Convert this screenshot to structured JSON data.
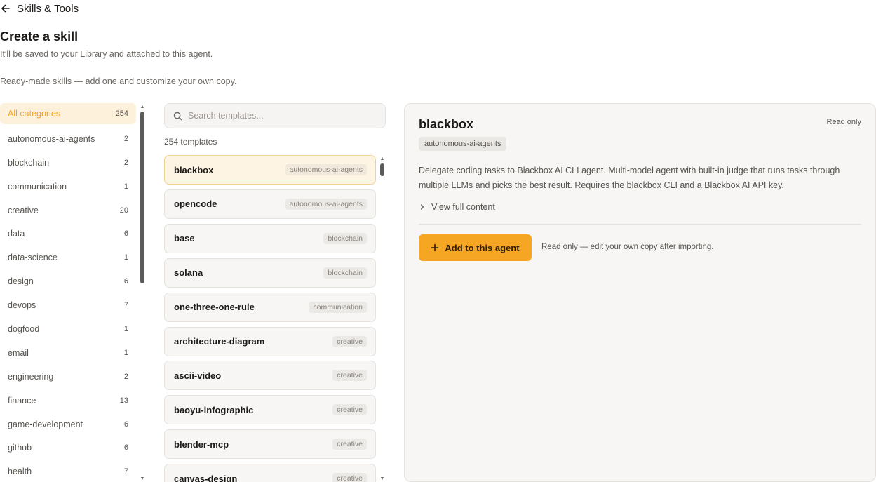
{
  "header": {
    "title": "Skills & Tools"
  },
  "page": {
    "title": "Create a skill",
    "subtitle": "It'll be saved to your Library and attached to this agent.",
    "section_note": "Ready-made skills — add one and customize your own copy."
  },
  "categories": [
    {
      "label": "All categories",
      "count": "254",
      "active": true
    },
    {
      "label": "autonomous-ai-agents",
      "count": "2"
    },
    {
      "label": "blockchain",
      "count": "2"
    },
    {
      "label": "communication",
      "count": "1"
    },
    {
      "label": "creative",
      "count": "20"
    },
    {
      "label": "data",
      "count": "6"
    },
    {
      "label": "data-science",
      "count": "1"
    },
    {
      "label": "design",
      "count": "6"
    },
    {
      "label": "devops",
      "count": "7"
    },
    {
      "label": "dogfood",
      "count": "1"
    },
    {
      "label": "email",
      "count": "1"
    },
    {
      "label": "engineering",
      "count": "2"
    },
    {
      "label": "finance",
      "count": "13"
    },
    {
      "label": "game-development",
      "count": "6"
    },
    {
      "label": "github",
      "count": "6"
    },
    {
      "label": "health",
      "count": "7"
    }
  ],
  "search": {
    "placeholder": "Search templates...",
    "value": ""
  },
  "templates_count": "254 templates",
  "templates": [
    {
      "name": "blackbox",
      "tag": "autonomous-ai-agents",
      "selected": true
    },
    {
      "name": "opencode",
      "tag": "autonomous-ai-agents"
    },
    {
      "name": "base",
      "tag": "blockchain"
    },
    {
      "name": "solana",
      "tag": "blockchain"
    },
    {
      "name": "one-three-one-rule",
      "tag": "communication"
    },
    {
      "name": "architecture-diagram",
      "tag": "creative"
    },
    {
      "name": "ascii-video",
      "tag": "creative"
    },
    {
      "name": "baoyu-infographic",
      "tag": "creative"
    },
    {
      "name": "blender-mcp",
      "tag": "creative"
    },
    {
      "name": "canvas-design",
      "tag": "creative"
    }
  ],
  "detail": {
    "title": "blackbox",
    "read_only": "Read only",
    "category": "autonomous-ai-agents",
    "description": "Delegate coding tasks to Blackbox AI CLI agent. Multi-model agent with built-in judge that runs tasks through multiple LLMs and picks the best result. Requires the blackbox CLI and a Blackbox AI API key.",
    "expand_label": "View full content",
    "add_button": "Add to this agent",
    "add_note": "Read only — edit your own copy after importing."
  },
  "colors": {
    "accent": "#f5a623",
    "accent_text": "#f0a321",
    "selected_bg": "#fdf4e3"
  }
}
